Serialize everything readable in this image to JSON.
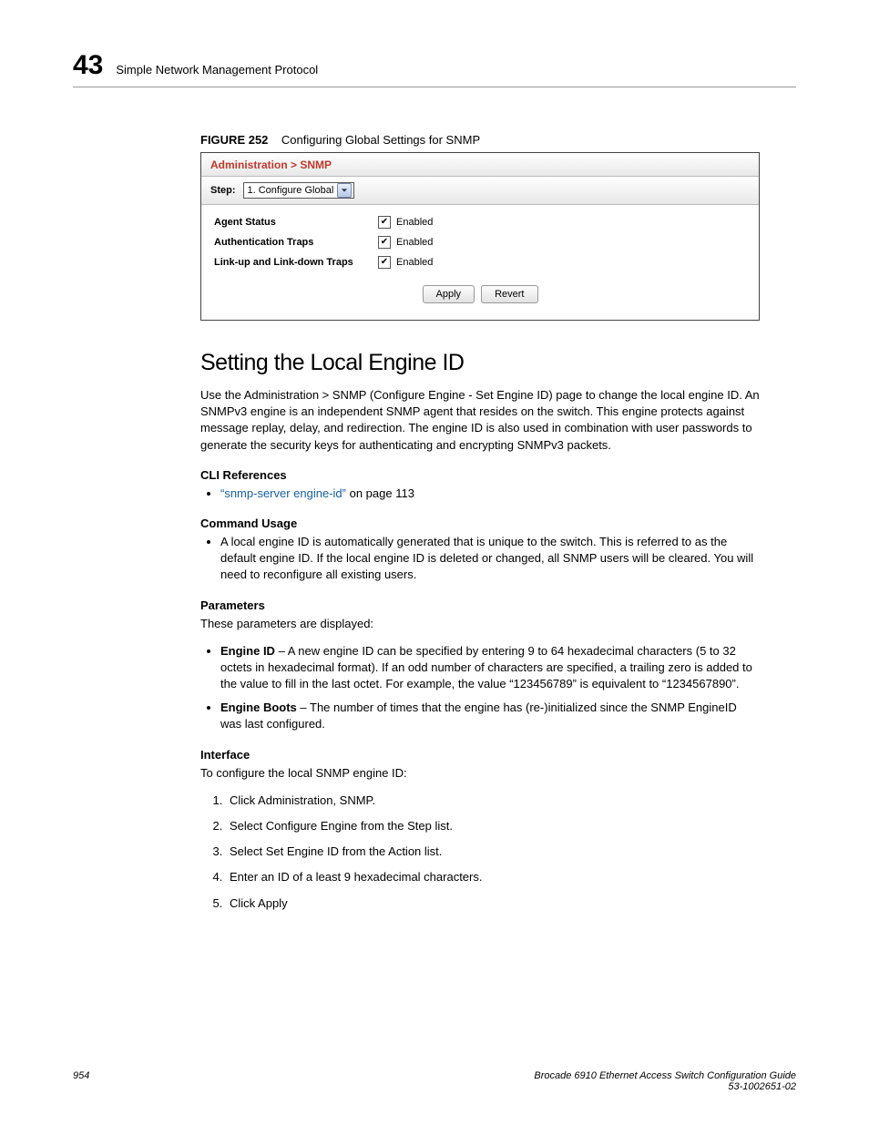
{
  "header": {
    "chapter": "43",
    "title": "Simple Network Management Protocol"
  },
  "figure": {
    "label": "FIGURE 252",
    "caption": "Configuring Global Settings for SNMP",
    "breadcrumb": "Administration >  SNMP",
    "step_label": "Step:",
    "step_value": "1. Configure Global",
    "rows": [
      {
        "label": "Agent Status",
        "value": "Enabled"
      },
      {
        "label": "Authentication Traps",
        "value": "Enabled"
      },
      {
        "label": "Link-up and Link-down Traps",
        "value": "Enabled"
      }
    ],
    "apply": "Apply",
    "revert": "Revert"
  },
  "section": {
    "title": "Setting the Local Engine ID",
    "intro": "Use the Administration > SNMP (Configure Engine - Set Engine ID) page to change the local engine ID. An SNMPv3 engine is an independent SNMP agent that resides on the switch. This engine protects against message replay, delay, and redirection. The engine ID is also used in combination with user passwords to generate the security keys for authenticating and encrypting SNMPv3 packets.",
    "cli_ref_heading": "CLI References",
    "cli_ref_link": "“snmp-server engine-id”",
    "cli_ref_suffix": " on page 113",
    "cmd_usage_heading": "Command Usage",
    "cmd_usage_text": "A local engine ID is automatically generated that is unique to the switch. This is referred to as the default engine ID. If the local engine ID is deleted or changed, all SNMP users will be cleared. You will need to reconfigure all existing users.",
    "params_heading": "Parameters",
    "params_intro": "These parameters are displayed:",
    "params": [
      {
        "term": "Engine ID",
        "desc": " – A new engine ID can be specified by entering 9 to 64 hexadecimal characters (5 to 32 octets in hexadecimal format). If an odd number of characters are specified, a trailing zero is added to the value to fill in the last octet. For example, the value “123456789” is equivalent to “1234567890”."
      },
      {
        "term": "Engine Boots",
        "desc": " – The number of times that the engine has (re-)initialized since the SNMP EngineID was last configured."
      }
    ],
    "interface_heading": "Interface",
    "interface_intro": "To configure the local SNMP engine ID:",
    "steps": [
      "Click Administration, SNMP.",
      "Select Configure Engine from the Step list.",
      "Select Set Engine ID from the Action list.",
      "Enter an ID of a least 9 hexadecimal characters.",
      "Click Apply"
    ]
  },
  "footer": {
    "page": "954",
    "book": "Brocade 6910 Ethernet Access Switch Configuration Guide",
    "docnum": "53-1002651-02"
  }
}
